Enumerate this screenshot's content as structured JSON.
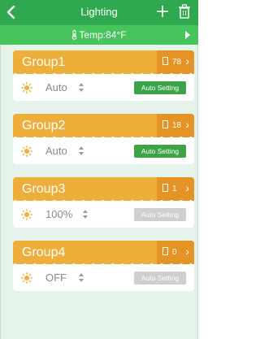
{
  "header": {
    "title": "Lighting"
  },
  "temp_bar": {
    "label": "Temp:84°F"
  },
  "groups": [
    {
      "name": "Group1",
      "count": "78",
      "mode": "Auto",
      "button": "Auto Setting",
      "button_enabled": true
    },
    {
      "name": "Group2",
      "count": "18",
      "mode": "Auto",
      "button": "Auto Setting",
      "button_enabled": true
    },
    {
      "name": "Group3",
      "count": "1",
      "mode": "100%",
      "button": "Auto Setting",
      "button_enabled": false
    },
    {
      "name": "Group4",
      "count": "0",
      "mode": "OFF",
      "button": "Auto Setting",
      "button_enabled": false
    }
  ],
  "colors": {
    "header": "#2fa84f",
    "temp_bar": "#47c55d",
    "card_header": "#eeae3a",
    "count_box": "#e39424",
    "enabled_button": "#3ca447",
    "disabled_button": "#cfcfcf"
  },
  "icons": {
    "back": "back-chevron-icon",
    "add": "plus-icon",
    "delete": "trash-icon",
    "temperature": "thermometer-icon",
    "light": "sun-icon",
    "bulb": "bulb-icon"
  }
}
